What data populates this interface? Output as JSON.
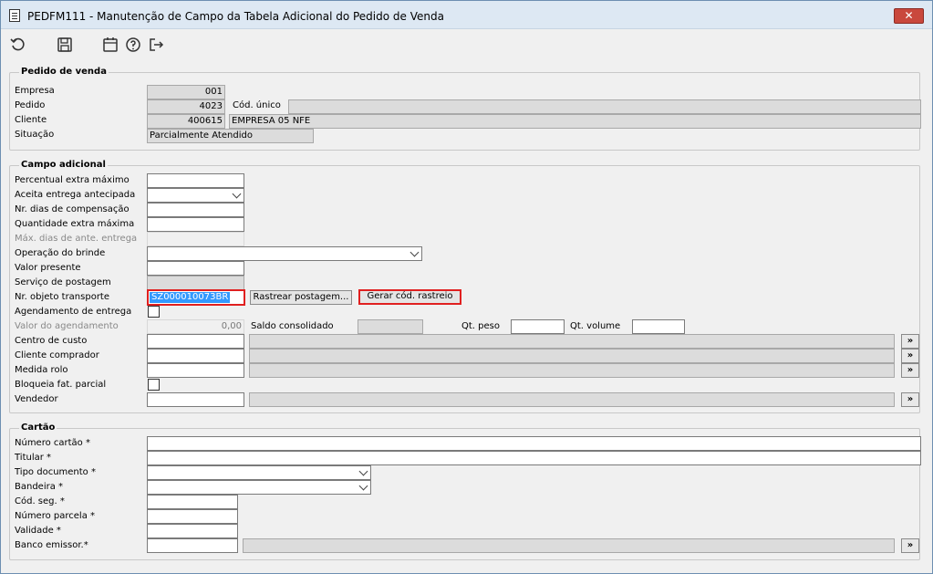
{
  "window": {
    "title": "PEDFM111 - Manutenção de Campo da Tabela Adicional do Pedido de Venda",
    "close_label": "✕"
  },
  "toolbar": [
    "refresh-icon",
    "save-icon",
    "calendar-icon",
    "help-icon",
    "exit-icon"
  ],
  "pedido": {
    "legend": "Pedido de venda",
    "empresa_label": "Empresa",
    "empresa_value": "001",
    "pedido_label": "Pedido",
    "pedido_value": "4023",
    "cod_unico_label": "Cód. único",
    "cod_unico_value": "",
    "cliente_label": "Cliente",
    "cliente_code": "400615",
    "cliente_name": "EMPRESA 05 NFE",
    "situacao_label": "Situação",
    "situacao_value": "Parcialmente Atendido"
  },
  "adicional": {
    "legend": "Campo adicional",
    "percentual_label": "Percentual extra máximo",
    "aceita_label": "Aceita entrega antecipada",
    "nr_dias_label": "Nr. dias de compensação",
    "qtd_extra_label": "Quantidade extra máxima",
    "max_dias_label": "Máx. dias de ante. entrega",
    "operacao_label": "Operação do brinde",
    "valor_presente_label": "Valor presente",
    "servico_label": "Serviço de postagem",
    "nr_objeto_label": "Nr. objeto transporte",
    "nr_objeto_value": "SZ000010073BR",
    "rastrear_label": "Rastrear postagem...",
    "gerar_label": "Gerar cód. rastreio",
    "agendamento_label": "Agendamento de entrega",
    "valor_agendamento_label": "Valor do agendamento",
    "valor_agendamento_value": "0,00",
    "saldo_label": "Saldo consolidado",
    "qt_peso_label": "Qt. peso",
    "qt_volume_label": "Qt. volume",
    "centro_label": "Centro de custo",
    "cliente_comprador_label": "Cliente comprador",
    "medida_label": "Medida rolo",
    "bloqueia_label": "Bloqueia fat. parcial",
    "vendedor_label": "Vendedor",
    "lookup_label": "»"
  },
  "cartao": {
    "legend": "Cartão",
    "numero_label": "Número cartão *",
    "titular_label": "Titular *",
    "tipo_doc_label": "Tipo documento *",
    "bandeira_label": "Bandeira *",
    "cod_seg_label": "Cód. seg. *",
    "numero_parcela_label": "Número parcela *",
    "validade_label": "Validade *",
    "banco_label": "Banco emissor.*",
    "lookup_label": "»"
  }
}
